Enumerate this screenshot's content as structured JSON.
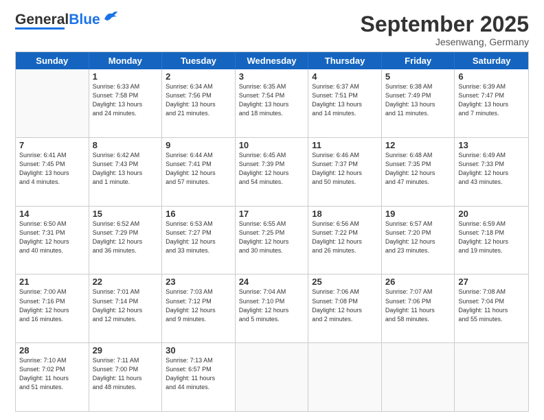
{
  "header": {
    "logo_general": "General",
    "logo_blue": "Blue",
    "month_title": "September 2025",
    "location": "Jesenwang, Germany"
  },
  "days_of_week": [
    "Sunday",
    "Monday",
    "Tuesday",
    "Wednesday",
    "Thursday",
    "Friday",
    "Saturday"
  ],
  "weeks": [
    [
      {
        "day": "",
        "info": ""
      },
      {
        "day": "1",
        "info": "Sunrise: 6:33 AM\nSunset: 7:58 PM\nDaylight: 13 hours\nand 24 minutes."
      },
      {
        "day": "2",
        "info": "Sunrise: 6:34 AM\nSunset: 7:56 PM\nDaylight: 13 hours\nand 21 minutes."
      },
      {
        "day": "3",
        "info": "Sunrise: 6:35 AM\nSunset: 7:54 PM\nDaylight: 13 hours\nand 18 minutes."
      },
      {
        "day": "4",
        "info": "Sunrise: 6:37 AM\nSunset: 7:51 PM\nDaylight: 13 hours\nand 14 minutes."
      },
      {
        "day": "5",
        "info": "Sunrise: 6:38 AM\nSunset: 7:49 PM\nDaylight: 13 hours\nand 11 minutes."
      },
      {
        "day": "6",
        "info": "Sunrise: 6:39 AM\nSunset: 7:47 PM\nDaylight: 13 hours\nand 7 minutes."
      }
    ],
    [
      {
        "day": "7",
        "info": "Sunrise: 6:41 AM\nSunset: 7:45 PM\nDaylight: 13 hours\nand 4 minutes."
      },
      {
        "day": "8",
        "info": "Sunrise: 6:42 AM\nSunset: 7:43 PM\nDaylight: 13 hours\nand 1 minute."
      },
      {
        "day": "9",
        "info": "Sunrise: 6:44 AM\nSunset: 7:41 PM\nDaylight: 12 hours\nand 57 minutes."
      },
      {
        "day": "10",
        "info": "Sunrise: 6:45 AM\nSunset: 7:39 PM\nDaylight: 12 hours\nand 54 minutes."
      },
      {
        "day": "11",
        "info": "Sunrise: 6:46 AM\nSunset: 7:37 PM\nDaylight: 12 hours\nand 50 minutes."
      },
      {
        "day": "12",
        "info": "Sunrise: 6:48 AM\nSunset: 7:35 PM\nDaylight: 12 hours\nand 47 minutes."
      },
      {
        "day": "13",
        "info": "Sunrise: 6:49 AM\nSunset: 7:33 PM\nDaylight: 12 hours\nand 43 minutes."
      }
    ],
    [
      {
        "day": "14",
        "info": "Sunrise: 6:50 AM\nSunset: 7:31 PM\nDaylight: 12 hours\nand 40 minutes."
      },
      {
        "day": "15",
        "info": "Sunrise: 6:52 AM\nSunset: 7:29 PM\nDaylight: 12 hours\nand 36 minutes."
      },
      {
        "day": "16",
        "info": "Sunrise: 6:53 AM\nSunset: 7:27 PM\nDaylight: 12 hours\nand 33 minutes."
      },
      {
        "day": "17",
        "info": "Sunrise: 6:55 AM\nSunset: 7:25 PM\nDaylight: 12 hours\nand 30 minutes."
      },
      {
        "day": "18",
        "info": "Sunrise: 6:56 AM\nSunset: 7:22 PM\nDaylight: 12 hours\nand 26 minutes."
      },
      {
        "day": "19",
        "info": "Sunrise: 6:57 AM\nSunset: 7:20 PM\nDaylight: 12 hours\nand 23 minutes."
      },
      {
        "day": "20",
        "info": "Sunrise: 6:59 AM\nSunset: 7:18 PM\nDaylight: 12 hours\nand 19 minutes."
      }
    ],
    [
      {
        "day": "21",
        "info": "Sunrise: 7:00 AM\nSunset: 7:16 PM\nDaylight: 12 hours\nand 16 minutes."
      },
      {
        "day": "22",
        "info": "Sunrise: 7:01 AM\nSunset: 7:14 PM\nDaylight: 12 hours\nand 12 minutes."
      },
      {
        "day": "23",
        "info": "Sunrise: 7:03 AM\nSunset: 7:12 PM\nDaylight: 12 hours\nand 9 minutes."
      },
      {
        "day": "24",
        "info": "Sunrise: 7:04 AM\nSunset: 7:10 PM\nDaylight: 12 hours\nand 5 minutes."
      },
      {
        "day": "25",
        "info": "Sunrise: 7:06 AM\nSunset: 7:08 PM\nDaylight: 12 hours\nand 2 minutes."
      },
      {
        "day": "26",
        "info": "Sunrise: 7:07 AM\nSunset: 7:06 PM\nDaylight: 11 hours\nand 58 minutes."
      },
      {
        "day": "27",
        "info": "Sunrise: 7:08 AM\nSunset: 7:04 PM\nDaylight: 11 hours\nand 55 minutes."
      }
    ],
    [
      {
        "day": "28",
        "info": "Sunrise: 7:10 AM\nSunset: 7:02 PM\nDaylight: 11 hours\nand 51 minutes."
      },
      {
        "day": "29",
        "info": "Sunrise: 7:11 AM\nSunset: 7:00 PM\nDaylight: 11 hours\nand 48 minutes."
      },
      {
        "day": "30",
        "info": "Sunrise: 7:13 AM\nSunset: 6:57 PM\nDaylight: 11 hours\nand 44 minutes."
      },
      {
        "day": "",
        "info": ""
      },
      {
        "day": "",
        "info": ""
      },
      {
        "day": "",
        "info": ""
      },
      {
        "day": "",
        "info": ""
      }
    ]
  ]
}
